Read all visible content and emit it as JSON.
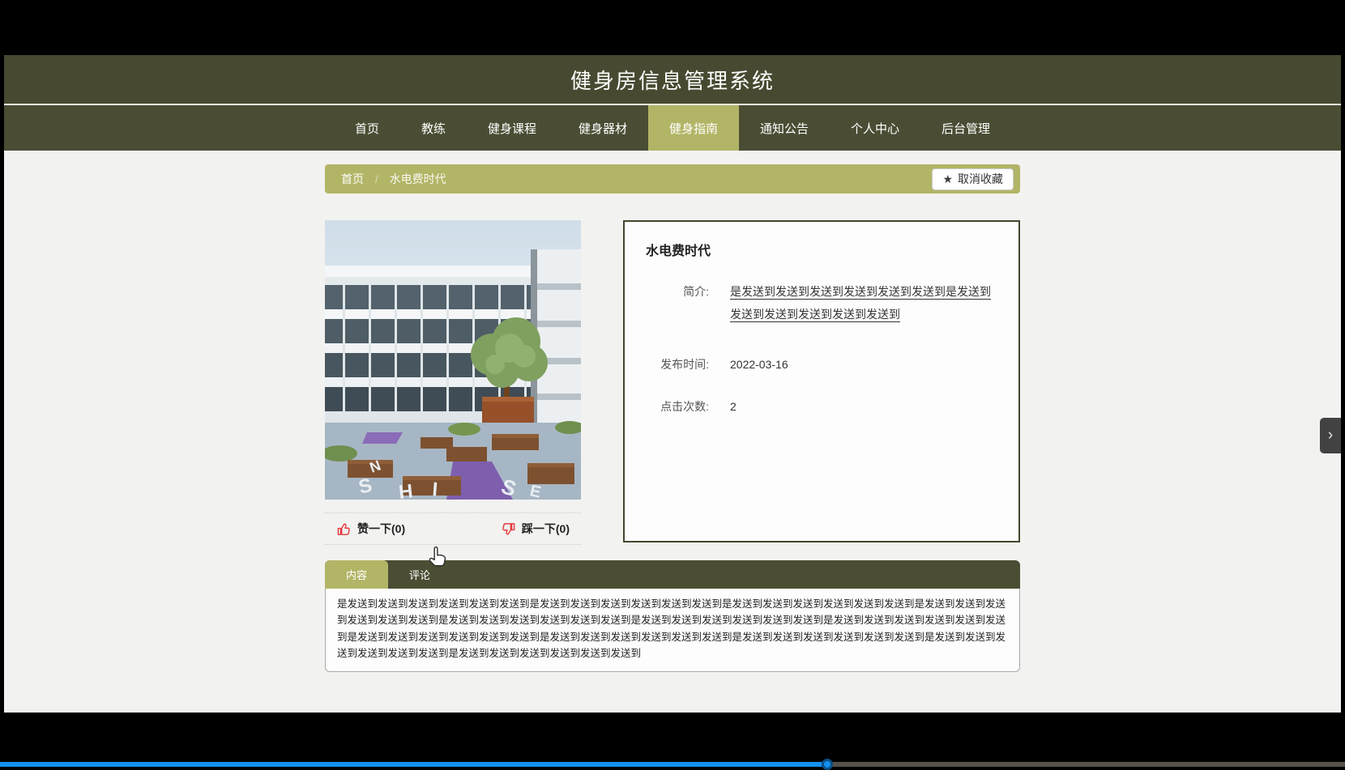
{
  "header": {
    "title": "健身房信息管理系统"
  },
  "nav": {
    "items": [
      {
        "label": "首页"
      },
      {
        "label": "教练"
      },
      {
        "label": "健身课程"
      },
      {
        "label": "健身器材"
      },
      {
        "label": "健身指南"
      },
      {
        "label": "通知公告"
      },
      {
        "label": "个人中心"
      },
      {
        "label": "后台管理"
      }
    ],
    "active_item": "健身指南"
  },
  "breadcrumb": {
    "home": "首页",
    "separator": "/",
    "current": "水电费时代"
  },
  "favorite": {
    "star_icon": "★",
    "label": "取消收藏"
  },
  "article": {
    "title": "水电费时代",
    "rows": [
      {
        "label": "简介:",
        "value": "是发送到发送到发送到发送到发送到发送到是发送到发送到发送到发送到发送到发送到"
      },
      {
        "label": "发布时间:",
        "value": "2022-03-16"
      },
      {
        "label": "点击次数:",
        "value": "2"
      }
    ]
  },
  "actions": {
    "like": "赞一下(0)",
    "dislike": "踩一下(0)"
  },
  "tabs": {
    "items": [
      {
        "label": "内容",
        "active": true
      },
      {
        "label": "评论",
        "active": false
      }
    ]
  },
  "content": {
    "text": "是发送到发送到发送到发送到发送到发送到是发送到发送到发送到发送到发送到发送到是发送到发送到发送到发送到发送到发送到是发送到发送到发送到发送到发送到发送到是发送到发送到发送到发送到发送到发送到是发送到发送到发送到发送到发送到发送到是发送到发送到发送到发送到发送到发送到是发送到发送到发送到发送到发送到发送到是发送到发送到发送到发送到发送到发送到是发送到发送到发送到发送到发送到发送到是发送到发送到发送到发送到发送到发送到是发送到发送到发送到发送到发送到发送到"
  },
  "image": {
    "letters": [
      "S",
      "H",
      "I",
      "N",
      "E",
      "S"
    ]
  },
  "side_toggle": {
    "icon": "›"
  },
  "player": {
    "progress_percent": "61.5"
  },
  "colors": {
    "header_olive": "#474a30",
    "accent_khaki": "#b2b566",
    "like_red": "#e4393c",
    "player_blue": "#1390f0",
    "page_bg": "#f2f2f0"
  }
}
